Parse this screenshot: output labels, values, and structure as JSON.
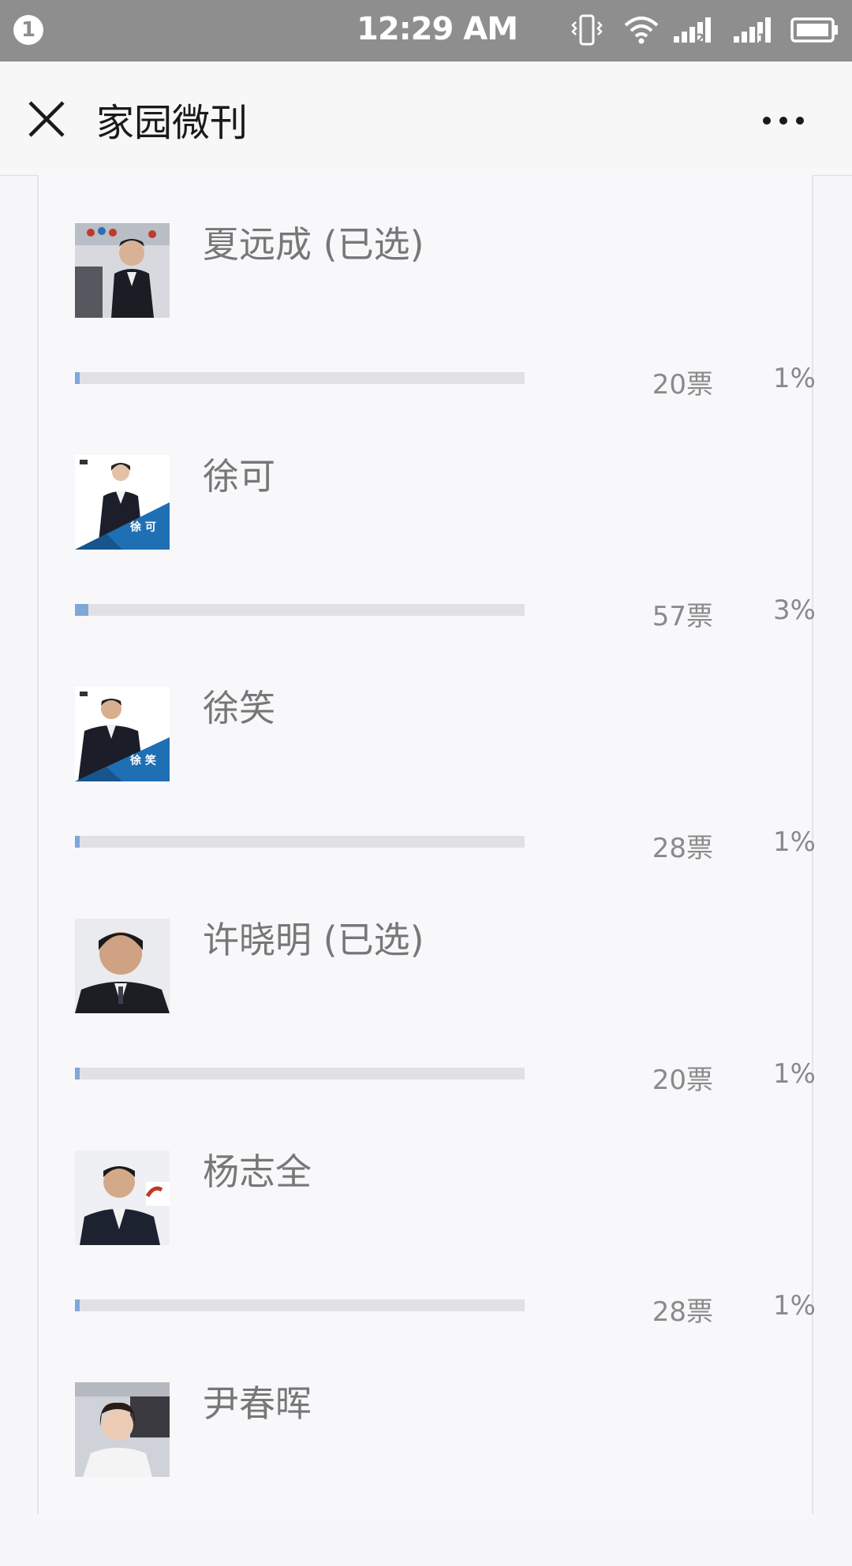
{
  "status_bar": {
    "notification_count": "1",
    "time": "12:29 AM",
    "sim1": "2",
    "sim2": "1",
    "colors": {
      "background": "#8e8e8e",
      "foreground": "#ffffff"
    }
  },
  "title_bar": {
    "title": "家园微刊",
    "close_icon": "close-icon",
    "more_icon": "more-icon"
  },
  "vote_bar_color": "#7fa7d8",
  "candidates": [
    {
      "name": "夏远成 (已选)",
      "votes": "20票",
      "percent": "1%",
      "fraction": 0.01,
      "avatar": "man-dark-suit-photo"
    },
    {
      "name": "徐可",
      "votes": "57票",
      "percent": "3%",
      "fraction": 0.03,
      "avatar": "woman-suit-poster",
      "avatar_caption": "徐 可"
    },
    {
      "name": "徐笑",
      "votes": "28票",
      "percent": "1%",
      "fraction": 0.01,
      "avatar": "man-suit-poster",
      "avatar_caption": "徐 笑"
    },
    {
      "name": "许晓明 (已选)",
      "votes": "20票",
      "percent": "1%",
      "fraction": 0.01,
      "avatar": "man-selfie-photo"
    },
    {
      "name": "杨志全",
      "votes": "28票",
      "percent": "1%",
      "fraction": 0.01,
      "avatar": "man-suit-office-photo"
    },
    {
      "name": "尹春晖",
      "avatar": "woman-selfie-photo"
    }
  ]
}
